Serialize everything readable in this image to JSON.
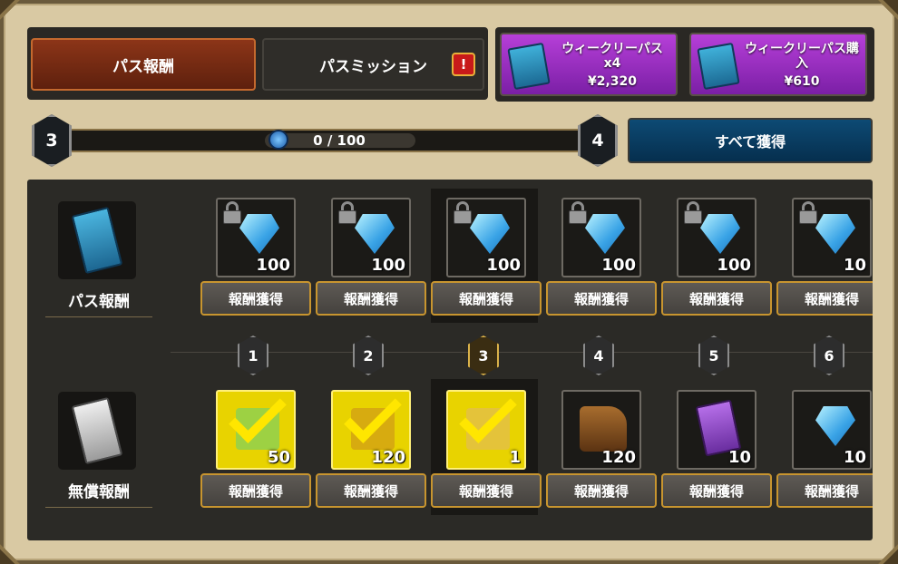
{
  "tabs": {
    "rewards": "パス報酬",
    "missions": "パスミッション",
    "alert_mark": "!"
  },
  "purchases": [
    {
      "title": "ウィークリーパス x4",
      "price": "¥2,320"
    },
    {
      "title": "ウィークリーパス購入",
      "price": "¥610"
    }
  ],
  "progress": {
    "level_current": "3",
    "level_next": "4",
    "text": "0 / 100",
    "fraction": 0
  },
  "claim_all_label": "すべて獲得",
  "rows": {
    "pass_label": "パス報酬",
    "free_label": "無償報酬"
  },
  "columns": [
    {
      "level": "1",
      "pass_qty": "100",
      "free_qty": "50",
      "free_item": "green-gem",
      "claimed": true
    },
    {
      "level": "2",
      "pass_qty": "100",
      "free_qty": "120",
      "free_item": "gold-ring",
      "claimed": true
    },
    {
      "level": "3",
      "pass_qty": "100",
      "free_qty": "1",
      "free_item": "scroll",
      "claimed": true,
      "current": true
    },
    {
      "level": "4",
      "pass_qty": "100",
      "free_qty": "120",
      "free_item": "boot",
      "claimed": false
    },
    {
      "level": "5",
      "pass_qty": "100",
      "free_qty": "10",
      "free_item": "purple-card",
      "claimed": false
    },
    {
      "level": "6",
      "pass_qty": "10",
      "free_qty": "10",
      "free_item": "diamond",
      "claimed": false
    }
  ],
  "claim_label": "報酬獲得"
}
